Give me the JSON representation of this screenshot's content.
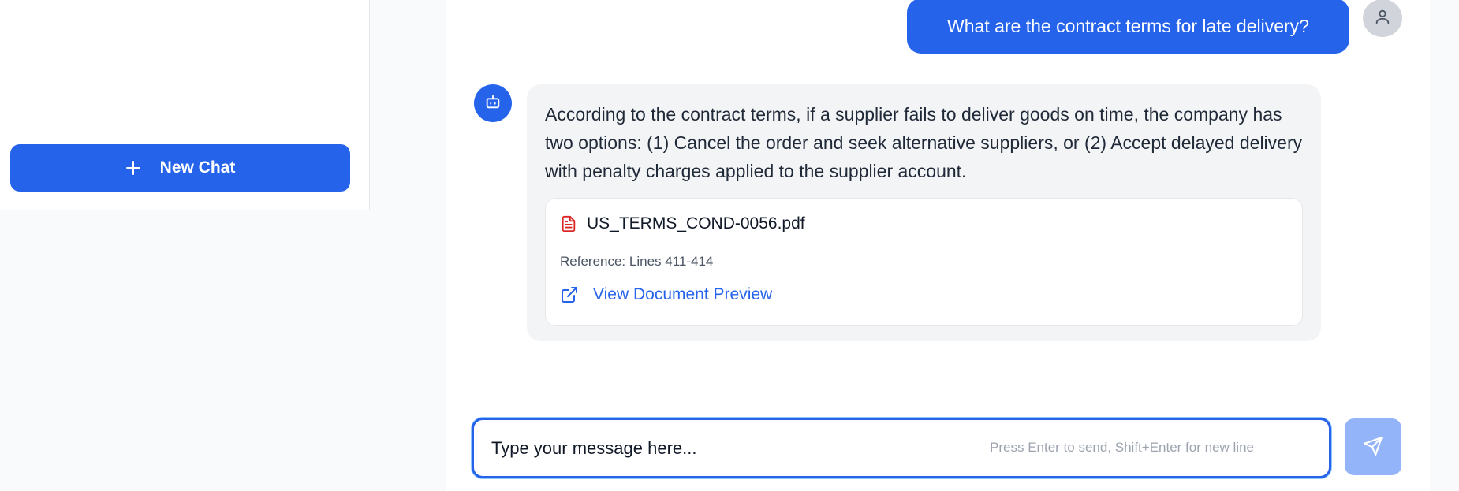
{
  "sidebar": {
    "new_chat_label": "New Chat"
  },
  "conversation": {
    "user_message": "What are the contract terms for late delivery?",
    "bot_message": "According to the contract terms, if a supplier fails to deliver goods on time, the company has two options: (1) Cancel the order and seek alternative suppliers, or (2) Accept delayed delivery with penalty charges applied to the supplier account.",
    "source": {
      "file_name": "US_TERMS_COND-0056.pdf",
      "reference": "Reference: Lines 411-414",
      "preview_label": "View Document Preview"
    }
  },
  "composer": {
    "placeholder": "Type your message here...",
    "hint": "Press Enter to send, Shift+Enter for new line"
  },
  "icons": {
    "plus": "plus-icon",
    "user": "user-icon",
    "bot": "bot-icon",
    "pdf": "file-text-icon",
    "external": "external-link-icon",
    "send": "send-icon"
  },
  "colors": {
    "accent": "#2563eb",
    "send_disabled": "#93b4f8",
    "pdf_icon": "#dc2626"
  }
}
